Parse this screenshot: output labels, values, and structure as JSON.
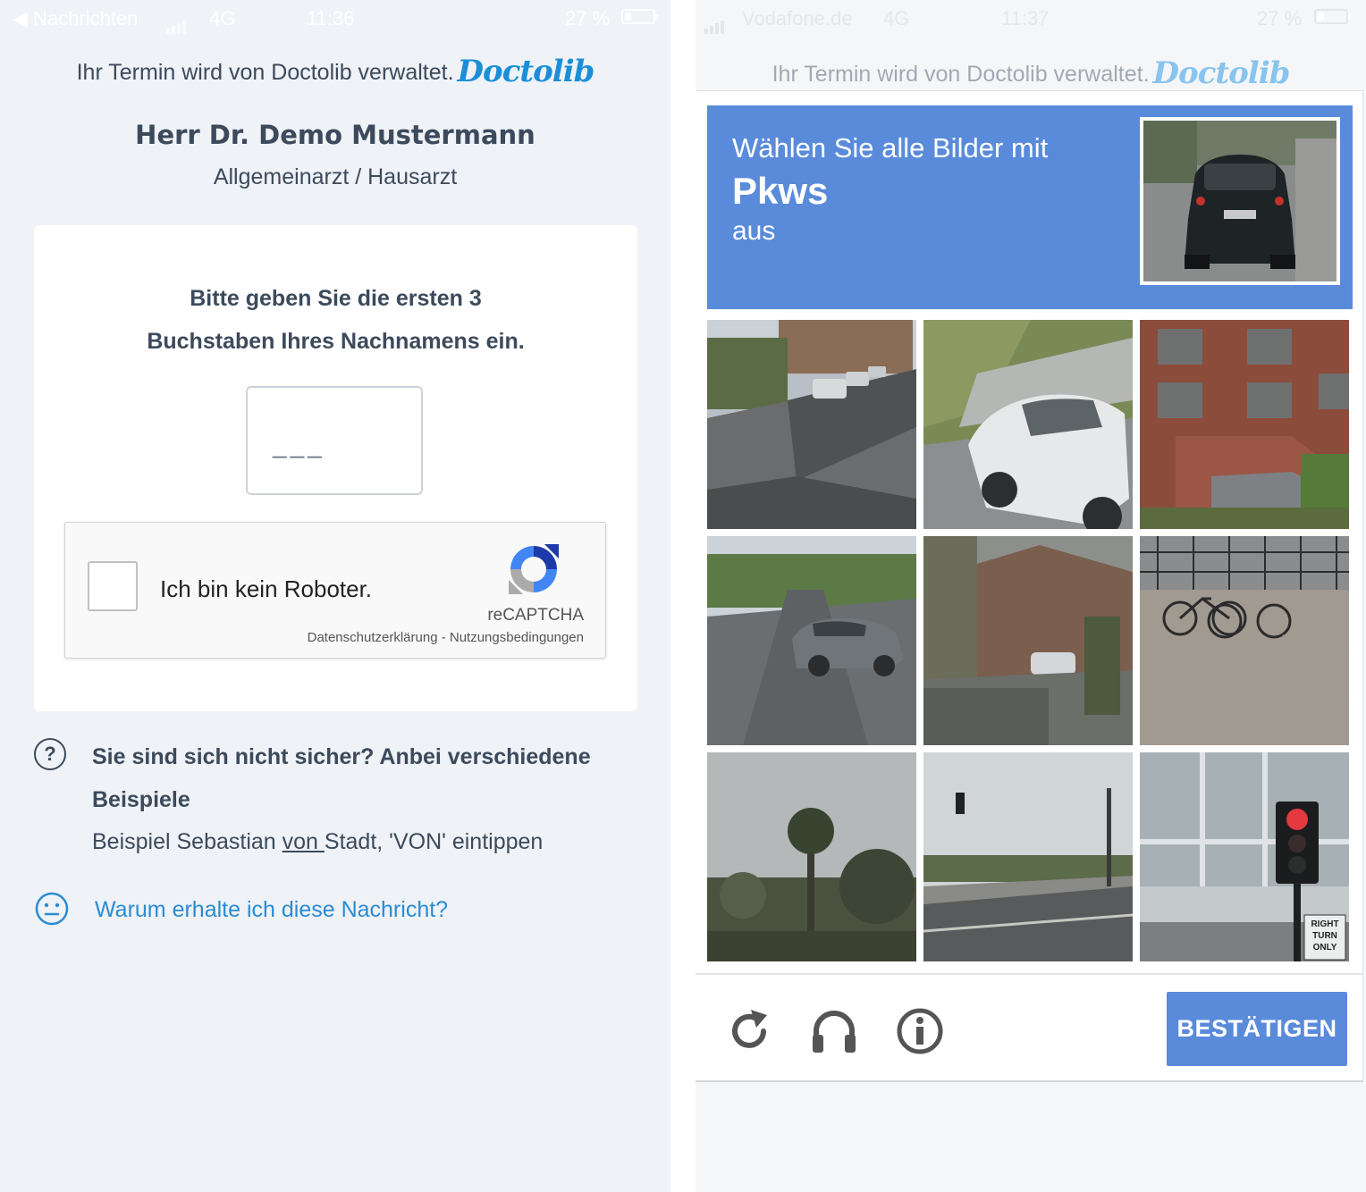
{
  "left": {
    "status": {
      "back_app": "◀ Nachrichten",
      "network": "4G",
      "time": "11:36",
      "battery": "27 %"
    },
    "managed_text": "Ihr Termin wird von Doctolib verwaltet.",
    "brand": "Doctolib",
    "doctor_name": "Herr Dr. Demo Mustermann",
    "doctor_specialty": "Allgemeinarzt / Hausarzt",
    "prompt_line1": "Bitte geben Sie die ersten 3",
    "prompt_line2": "Buchstaben Ihres Nachnamens ein.",
    "letters_placeholder": "___",
    "recaptcha": {
      "label": "Ich bin kein Roboter.",
      "brand": "reCAPTCHA",
      "links": "Datenschutzerklärung - Nutzungsbedingungen"
    },
    "help_icon": "?",
    "help_title": "Sie sind sich nicht sicher? Anbei verschiedene Beispiele",
    "example": {
      "prefix": "Beispiel Sebastian ",
      "underlined": "von ",
      "suffix": "Stadt, 'VON' eintippen"
    },
    "why_link": "Warum erhalte ich diese Nachricht?"
  },
  "right": {
    "status": {
      "carrier": "Vodafone.de",
      "network": "4G",
      "time": "11:37",
      "battery": "27 %"
    },
    "managed_text": "Ihr Termin wird von Doctolib verwaltet.",
    "brand": "Doctolib",
    "challenge": {
      "line1": "Wählen Sie alle Bilder mit",
      "object": "Pkws",
      "line3": "aus",
      "tiles": [
        {
          "scene": "street-with-parked-cars"
        },
        {
          "scene": "white-car-closeup"
        },
        {
          "scene": "brick-building-stairs"
        },
        {
          "scene": "intersection-grey-car"
        },
        {
          "scene": "house-driveway"
        },
        {
          "scene": "bicycles-at-fence"
        },
        {
          "scene": "palm-trees-sky"
        },
        {
          "scene": "road-with-traffic-light"
        },
        {
          "scene": "traffic-light-right-turn-only"
        }
      ],
      "tile_sign": "RIGHT TURN ONLY",
      "verify_label": "BESTÄTIGEN"
    },
    "icons": [
      "reload-icon",
      "headphones-icon",
      "info-icon"
    ]
  },
  "colors": {
    "doctolib_blue": "#1a8fd8",
    "link_blue": "#2a8bd4",
    "recaptcha_blue": "#5a8bdb",
    "text_dark": "#3c4a5c"
  }
}
